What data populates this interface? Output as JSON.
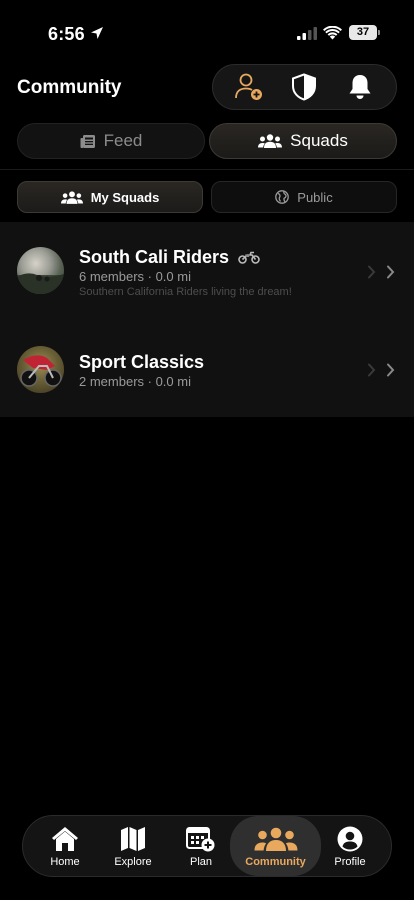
{
  "status_bar": {
    "time": "6:56",
    "battery": "37"
  },
  "header": {
    "title": "Community"
  },
  "tabs": [
    {
      "label": "Feed"
    },
    {
      "label": "Squads"
    }
  ],
  "sub_tabs": [
    {
      "label": "My Squads"
    },
    {
      "label": "Public"
    }
  ],
  "squads": [
    {
      "name": "South Cali Riders",
      "meta": "6 members · 0.0 mi",
      "description": "Southern California Riders living the dream!"
    },
    {
      "name": "Sport Classics",
      "meta": "2 members · 0.0 mi",
      "description": ""
    }
  ],
  "bottom_nav": [
    {
      "label": "Home",
      "icon": "house-icon"
    },
    {
      "label": "Explore",
      "icon": "map-icon"
    },
    {
      "label": "Plan",
      "icon": "calendar-plus-icon"
    },
    {
      "label": "Community",
      "icon": "people-icon"
    },
    {
      "label": "Profile",
      "icon": "person-circle-icon"
    }
  ],
  "colors": {
    "accent": "#e8a95f",
    "background": "#000000",
    "surface": "#111111"
  }
}
